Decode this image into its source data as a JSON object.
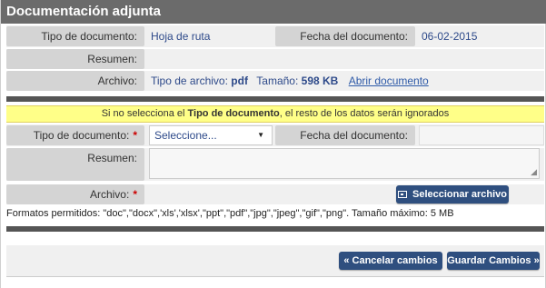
{
  "header": {
    "title": "Documentación adjunta"
  },
  "existing": {
    "tipo_label": "Tipo de documento:",
    "tipo_value": "Hoja de ruta",
    "fecha_label": "Fecha del documento:",
    "fecha_value": "06-02-2015",
    "resumen_label": "Resumen:",
    "archivo_label": "Archivo:",
    "tipo_archivo_prefix": "Tipo de archivo:",
    "tipo_archivo_value": "pdf",
    "tamano_prefix": "Tamaño:",
    "tamano_value": "598 KB",
    "abrir_link": "Abrir documento"
  },
  "warning": {
    "prefix": "Si no selecciona el ",
    "bold": "Tipo de documento",
    "suffix": ", el resto de los datos serán ignorados"
  },
  "new_doc": {
    "tipo_label": "Tipo de documento:",
    "required_mark": "*",
    "tipo_selected": "Seleccione...",
    "fecha_label": "Fecha del documento:",
    "resumen_label": "Resumen:",
    "archivo_label": "Archivo:",
    "select_file_button": "Seleccionar archivo",
    "formats_text": "Formatos permitidos: \"doc\",\"docx\",'xls','xlsx',\"ppt\",\"pdf\",\"jpg\",\"jpeg\",\"gif\",\"png\". Tamaño máximo: 5 MB"
  },
  "footer": {
    "cancel_button": "« Cancelar cambios",
    "save_button": "Guardar Cambios »"
  },
  "colors": {
    "title_bar": "#6b6b6b",
    "button": "#2f4f7f",
    "warning_bg": "#ffff88",
    "value_text": "#2e4a8a"
  }
}
